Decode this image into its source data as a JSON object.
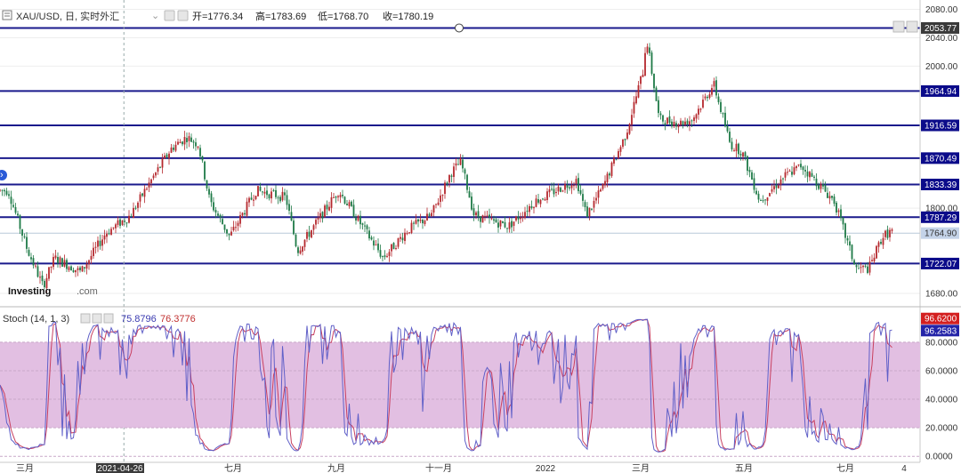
{
  "header": {
    "symbol": "XAU/USD, 日, 实时外汇",
    "open": "开=1776.34",
    "high": "高=1783.69",
    "low": "低=1768.70",
    "close": "收=1780.19"
  },
  "watermark": {
    "brand": "Investing",
    "suffix": ".com"
  },
  "stoch_header": {
    "label": "Stoch (14, 1, 3)",
    "k": "75.8796",
    "d": "76.3776"
  },
  "colors": {
    "level_line": "#1a1a8c",
    "up": "#b5282d",
    "down": "#1f7a47",
    "stoch_band": "#e2bfe2",
    "k_line": "#6060c8",
    "d_line": "#c84060"
  },
  "chart_data": [
    {
      "type": "candlestick",
      "title": "XAU/USD, 日, 实时外汇",
      "x_ticks": [
        "三月",
        "2021-04-26",
        "七月",
        "九月",
        "十一月",
        "2022",
        "三月",
        "五月",
        "七月",
        "4"
      ],
      "y_ticks": [
        "2080.00",
        "2040.00",
        "2000.00",
        "1800.00",
        "1680.00"
      ],
      "ylim": [
        1665,
        2090
      ],
      "levels": [
        {
          "value": 2053.77,
          "label": "2053.77"
        },
        {
          "value": 1964.94,
          "label": "1964.94"
        },
        {
          "value": 1916.59,
          "label": "1916.59"
        },
        {
          "value": 1870.49,
          "label": "1870.49"
        },
        {
          "value": 1833.39,
          "label": "1833.39"
        },
        {
          "value": 1787.29,
          "label": "1787.29"
        },
        {
          "value": 1722.07,
          "label": "1722.07"
        }
      ],
      "current_price": {
        "value": 1764.9,
        "label": "1764.90"
      },
      "anchors": [
        [
          "2021-02-15",
          1825
        ],
        [
          "2021-02-26",
          1745
        ],
        [
          "2021-03-08",
          1690
        ],
        [
          "2021-03-15",
          1730
        ],
        [
          "2021-03-31",
          1710
        ],
        [
          "2021-04-15",
          1765
        ],
        [
          "2021-04-30",
          1790
        ],
        [
          "2021-05-10",
          1830
        ],
        [
          "2021-05-25",
          1885
        ],
        [
          "2021-06-03",
          1900
        ],
        [
          "2021-06-10",
          1890
        ],
        [
          "2021-06-17",
          1810
        ],
        [
          "2021-06-29",
          1760
        ],
        [
          "2021-07-15",
          1825
        ],
        [
          "2021-08-02",
          1815
        ],
        [
          "2021-08-09",
          1740
        ],
        [
          "2021-08-25",
          1795
        ],
        [
          "2021-09-03",
          1825
        ],
        [
          "2021-09-20",
          1765
        ],
        [
          "2021-09-30",
          1730
        ],
        [
          "2021-10-15",
          1770
        ],
        [
          "2021-10-29",
          1790
        ],
        [
          "2021-11-10",
          1850
        ],
        [
          "2021-11-16",
          1865
        ],
        [
          "2021-11-24",
          1790
        ],
        [
          "2021-12-15",
          1775
        ],
        [
          "2021-12-31",
          1810
        ],
        [
          "2022-01-25",
          1840
        ],
        [
          "2022-01-31",
          1790
        ],
        [
          "2022-02-10",
          1830
        ],
        [
          "2022-02-24",
          1905
        ],
        [
          "2022-03-07",
          2000
        ],
        [
          "2022-03-08",
          2045
        ],
        [
          "2022-03-16",
          1925
        ],
        [
          "2022-03-29",
          1920
        ],
        [
          "2022-04-05",
          1925
        ],
        [
          "2022-04-18",
          1975
        ],
        [
          "2022-04-28",
          1890
        ],
        [
          "2022-05-05",
          1880
        ],
        [
          "2022-05-16",
          1810
        ],
        [
          "2022-05-31",
          1845
        ],
        [
          "2022-06-10",
          1860
        ],
        [
          "2022-06-20",
          1835
        ],
        [
          "2022-06-30",
          1810
        ],
        [
          "2022-07-13",
          1715
        ],
        [
          "2022-07-21",
          1715
        ],
        [
          "2022-07-29",
          1760
        ],
        [
          "2022-08-04",
          1768
        ]
      ]
    },
    {
      "type": "line",
      "title": "Stoch (14, 1, 3)",
      "y_ticks": [
        "80.0000",
        "60.0000",
        "40.0000",
        "20.0000",
        "0.0000"
      ],
      "ylim": [
        -3,
        103
      ],
      "band": [
        20,
        80
      ],
      "series": [
        {
          "name": "%K",
          "last": 96.62,
          "label": "96.6200"
        },
        {
          "name": "%D",
          "last": 96.2583,
          "label": "96.2583"
        }
      ]
    }
  ]
}
